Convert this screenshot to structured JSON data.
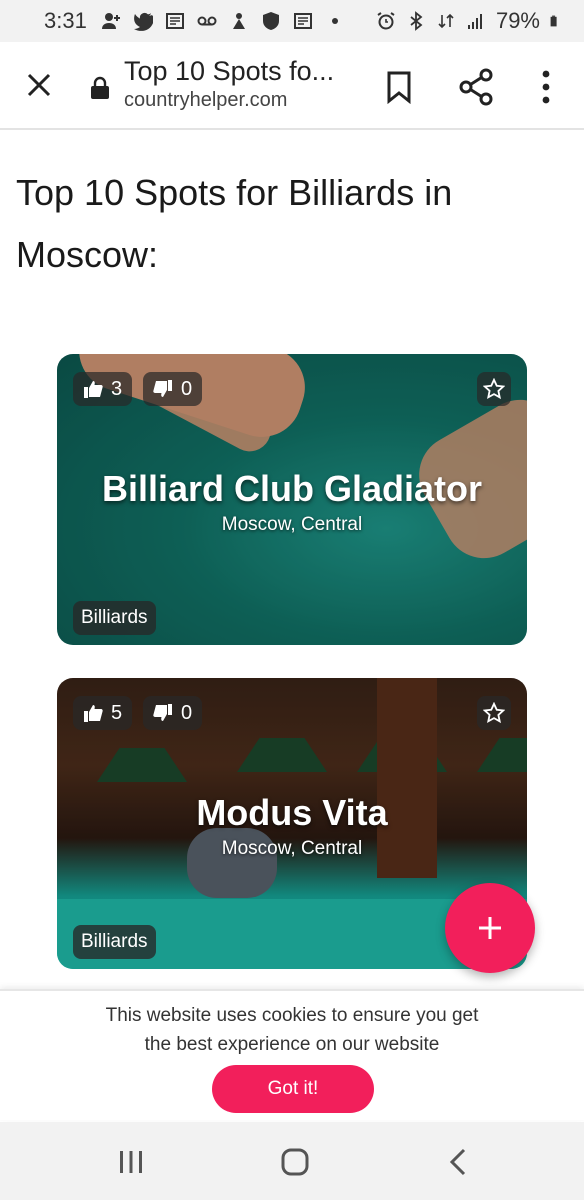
{
  "status_bar": {
    "time": "3:31",
    "battery": "79%",
    "icons_left": [
      "add-person-icon",
      "twitter-icon",
      "news-icon",
      "voicemail-icon",
      "app-icon",
      "shield-icon",
      "news-icon",
      "dot-icon"
    ],
    "icons_right": [
      "alarm-icon",
      "bluetooth-icon",
      "data-icon",
      "signal-icon",
      "battery-icon"
    ]
  },
  "browser": {
    "title": "Top 10 Spots fo...",
    "domain": "countryhelper.com"
  },
  "page": {
    "title": "Top 10 Spots for Billiards in Moscow:"
  },
  "cards": [
    {
      "name": "Billiard Club Gladiator",
      "location": "Moscow, Central",
      "likes": "3",
      "dislikes": "0",
      "tag": "Billiards"
    },
    {
      "name": "Modus Vita",
      "location": "Moscow, Central",
      "likes": "5",
      "dislikes": "0",
      "tag": "Billiards"
    }
  ],
  "fab": {
    "icon": "plus-icon"
  },
  "cookie": {
    "text": "This website uses cookies to ensure you get the best experience on our website",
    "button": "Got it!"
  },
  "colors": {
    "accent": "#f21f5b",
    "table_green": "#20bfae"
  }
}
